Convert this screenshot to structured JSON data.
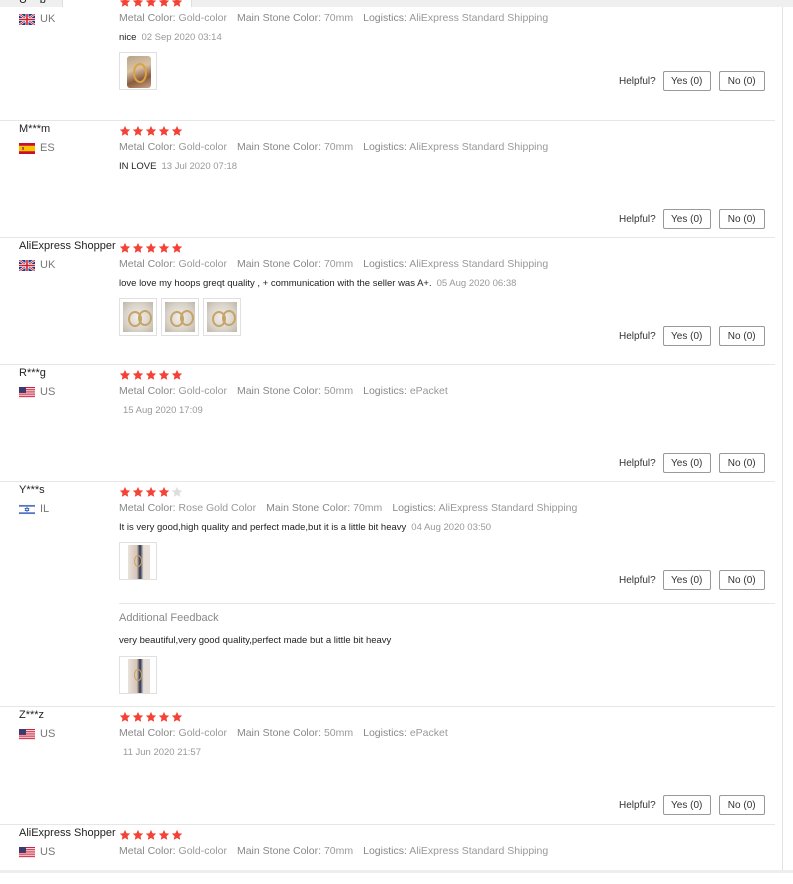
{
  "helpful_label": "Helpful?",
  "colors": {
    "star_filled": "#f44336",
    "star_empty": "#dddddd"
  },
  "reviews": [
    {
      "user": "U***b",
      "country": "UK",
      "flag": "gb",
      "rating": 5,
      "attributes": [
        {
          "label": "Metal Color:",
          "value": "Gold-color"
        },
        {
          "label": "Main Stone Color:",
          "value": "70mm"
        },
        {
          "label": "Logistics:",
          "value": "AliExpress Standard Shipping"
        }
      ],
      "text": "nice",
      "date": "02 Sep 2020 03:14",
      "photos": [
        {
          "icon": "gold-hoop-earring-photo"
        }
      ],
      "yes_label": "Yes (0)",
      "no_label": "No (0)"
    },
    {
      "user": "M***m",
      "country": "ES",
      "flag": "es",
      "rating": 5,
      "attributes": [
        {
          "label": "Metal Color:",
          "value": "Gold-color"
        },
        {
          "label": "Main Stone Color:",
          "value": "70mm"
        },
        {
          "label": "Logistics:",
          "value": "AliExpress Standard Shipping"
        }
      ],
      "text": "IN LOVE",
      "date": "13 Jul 2020 07:18",
      "photos": [],
      "yes_label": "Yes (0)",
      "no_label": "No (0)"
    },
    {
      "user": "AliExpress Shopper",
      "country": "UK",
      "flag": "gb",
      "rating": 5,
      "attributes": [
        {
          "label": "Metal Color:",
          "value": "Gold-color"
        },
        {
          "label": "Main Stone Color:",
          "value": "70mm"
        },
        {
          "label": "Logistics:",
          "value": "AliExpress Standard Shipping"
        }
      ],
      "text": "love love my hoops greqt quality , + communication with the seller was A+.",
      "date": "05 Aug 2020 06:38",
      "photos": [
        {
          "icon": "hoop-earrings-photo"
        },
        {
          "icon": "hoop-earrings-photo"
        },
        {
          "icon": "hoop-earrings-photo"
        }
      ],
      "yes_label": "Yes (0)",
      "no_label": "No (0)"
    },
    {
      "user": "R***g",
      "country": "US",
      "flag": "us",
      "rating": 5,
      "attributes": [
        {
          "label": "Metal Color:",
          "value": "Gold-color"
        },
        {
          "label": "Main Stone Color:",
          "value": "50mm"
        },
        {
          "label": "Logistics:",
          "value": "ePacket"
        }
      ],
      "text": "",
      "date": "15 Aug 2020 17:09",
      "photos": [],
      "yes_label": "Yes (0)",
      "no_label": "No (0)"
    },
    {
      "user": "Y***s",
      "country": "IL",
      "flag": "il",
      "rating": 4,
      "attributes": [
        {
          "label": "Metal Color:",
          "value": "Rose Gold Color"
        },
        {
          "label": "Main Stone Color:",
          "value": "70mm"
        },
        {
          "label": "Logistics:",
          "value": "AliExpress Standard Shipping"
        }
      ],
      "text": "It is very good,high quality and perfect made,but it is a little bit heavy",
      "date": "04 Aug 2020 03:50",
      "photos": [
        {
          "icon": "wearing-earring-photo"
        }
      ],
      "additional_feedback": {
        "title": "Additional Feedback",
        "text": "very beautiful,very good quality,perfect made but a little bit heavy",
        "photos": [
          {
            "icon": "wearing-earring-photo"
          }
        ]
      },
      "yes_label": "Yes (0)",
      "no_label": "No (0)"
    },
    {
      "user": "Z***z",
      "country": "US",
      "flag": "us",
      "rating": 5,
      "attributes": [
        {
          "label": "Metal Color:",
          "value": "Gold-color"
        },
        {
          "label": "Main Stone Color:",
          "value": "50mm"
        },
        {
          "label": "Logistics:",
          "value": "ePacket"
        }
      ],
      "text": "",
      "date": "11 Jun 2020 21:57",
      "photos": [],
      "yes_label": "Yes (0)",
      "no_label": "No (0)"
    },
    {
      "user": "AliExpress Shopper",
      "country": "US",
      "flag": "us",
      "rating": 5,
      "attributes": [
        {
          "label": "Metal Color:",
          "value": "Gold-color"
        },
        {
          "label": "Main Stone Color:",
          "value": "70mm"
        },
        {
          "label": "Logistics:",
          "value": "AliExpress Standard Shipping"
        }
      ]
    }
  ]
}
